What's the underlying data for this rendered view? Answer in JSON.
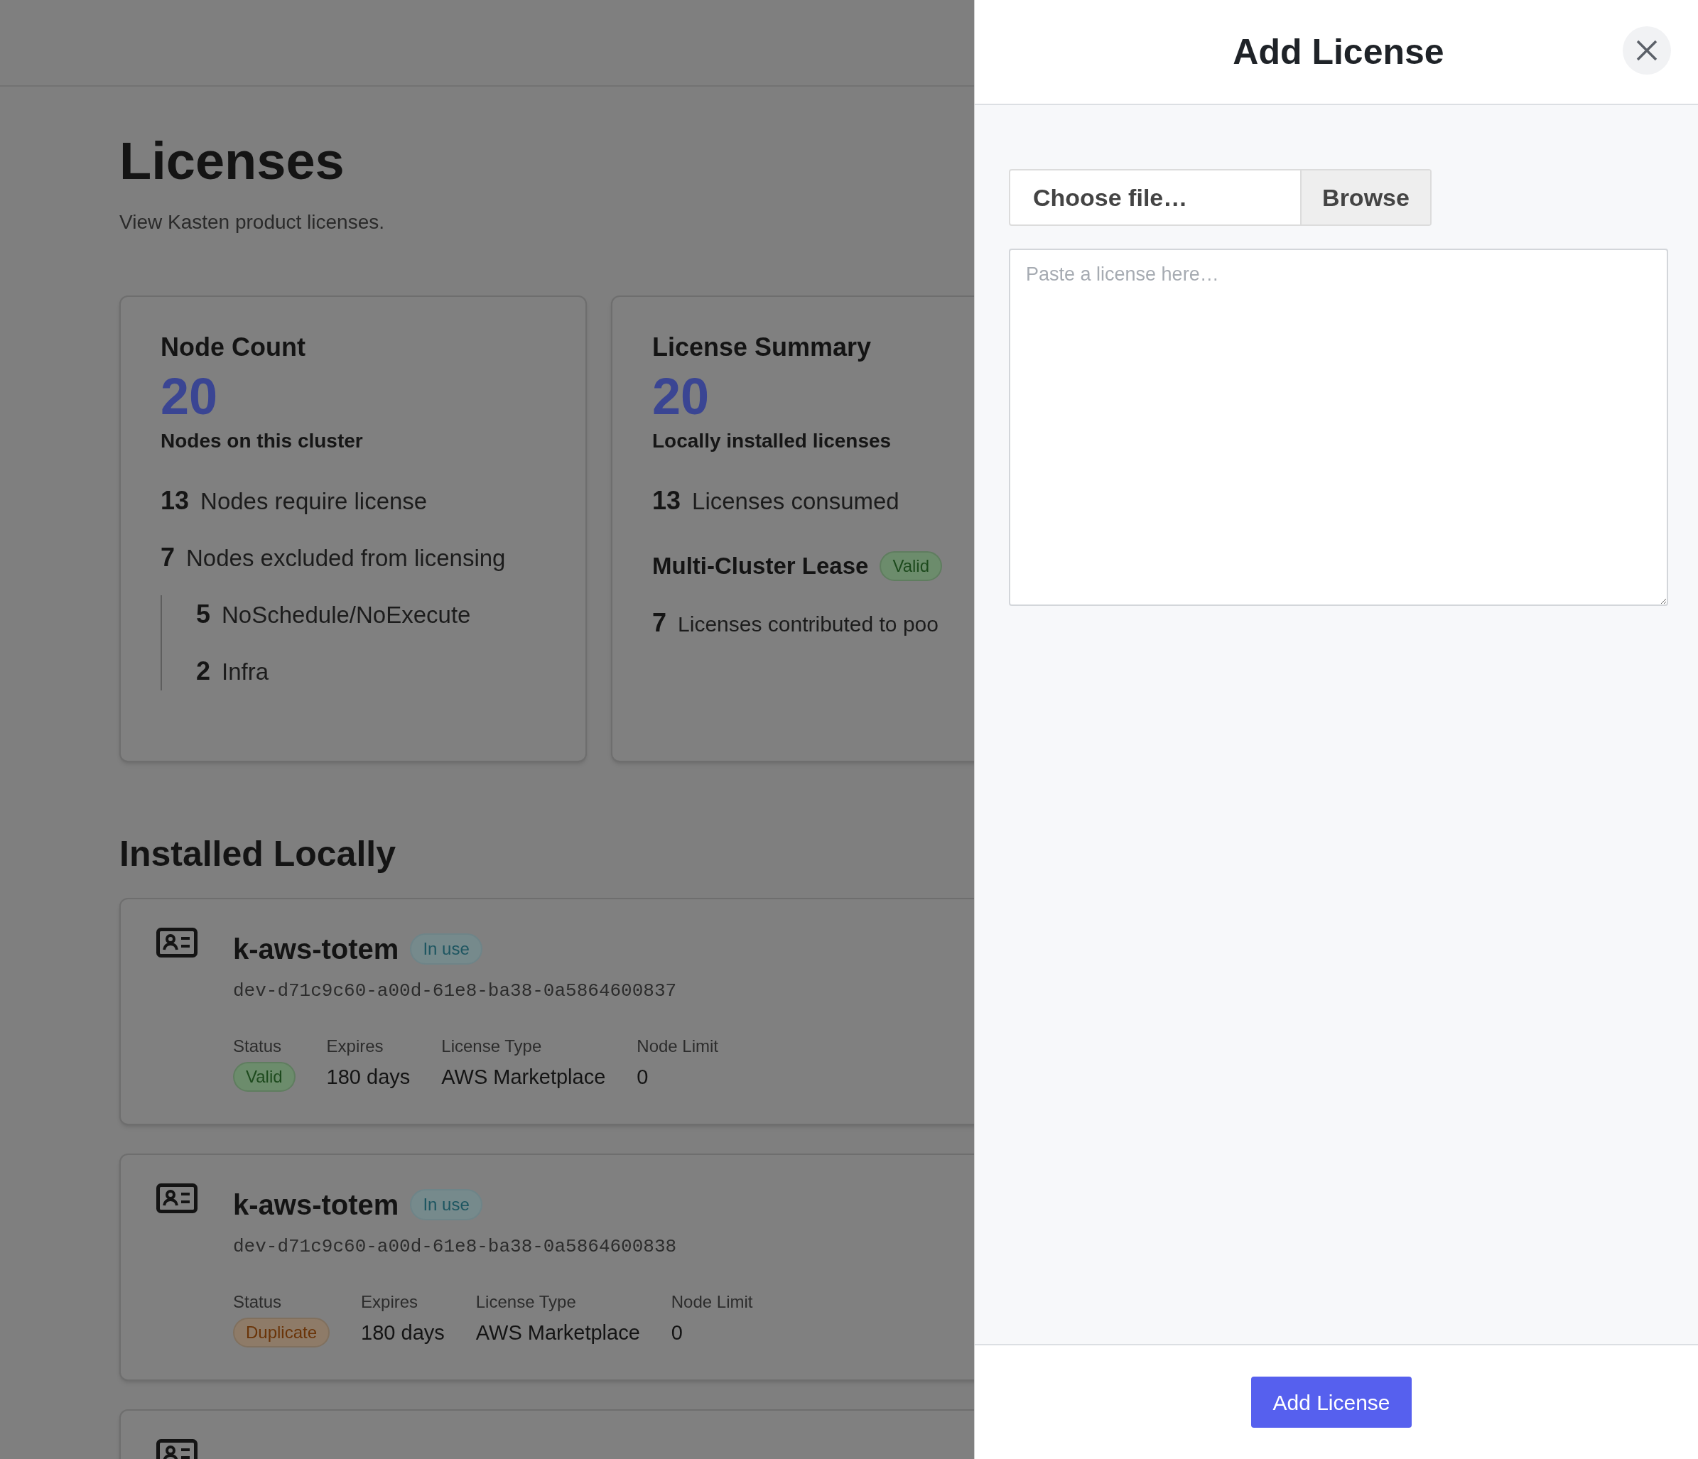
{
  "page": {
    "title": "Licenses",
    "subtitle": "View Kasten product licenses."
  },
  "node_count": {
    "title": "Node Count",
    "value": "20",
    "caption": "Nodes on this cluster",
    "rows": [
      {
        "count": "13",
        "label": "Nodes require license"
      },
      {
        "count": "7",
        "label": "Nodes excluded from licensing",
        "children": [
          {
            "count": "5",
            "label": "NoSchedule/NoExecute"
          },
          {
            "count": "2",
            "label": "Infra"
          }
        ]
      }
    ]
  },
  "license_summary": {
    "title": "License Summary",
    "value": "20",
    "caption": "Locally installed licenses",
    "rows": [
      {
        "count": "13",
        "label": "Licenses consumed"
      }
    ],
    "lease": {
      "label": "Multi-Cluster Lease",
      "status": {
        "label": "Valid",
        "kind": "success"
      }
    },
    "lease_rows": [
      {
        "count": "7",
        "label": "Licenses contributed to poo"
      }
    ]
  },
  "installed": {
    "title": "Installed Locally",
    "licenses": [
      {
        "name": "k-aws-totem",
        "badge": "In use",
        "id": "dev-d71c9c60-a00d-61e8-ba38-0a5864600837",
        "status_label": "Status",
        "status": {
          "label": "Valid",
          "kind": "success"
        },
        "fields": [
          {
            "label": "Expires",
            "value": "180 days"
          },
          {
            "label": "License Type",
            "value": "AWS Marketplace"
          },
          {
            "label": "Node Limit",
            "value": "0"
          }
        ]
      },
      {
        "name": "k-aws-totem",
        "badge": "In use",
        "id": "dev-d71c9c60-a00d-61e8-ba38-0a5864600838",
        "status_label": "Status",
        "status": {
          "label": "Duplicate",
          "kind": "warning"
        },
        "fields": [
          {
            "label": "Expires",
            "value": "180 days"
          },
          {
            "label": "License Type",
            "value": "AWS Marketplace"
          },
          {
            "label": "Node Limit",
            "value": "0"
          }
        ]
      }
    ]
  },
  "panel": {
    "title": "Add License",
    "file": {
      "placeholder": "Choose file…",
      "button": "Browse"
    },
    "license_text": {
      "placeholder": "Paste a license here…"
    },
    "submit": "Add License"
  }
}
